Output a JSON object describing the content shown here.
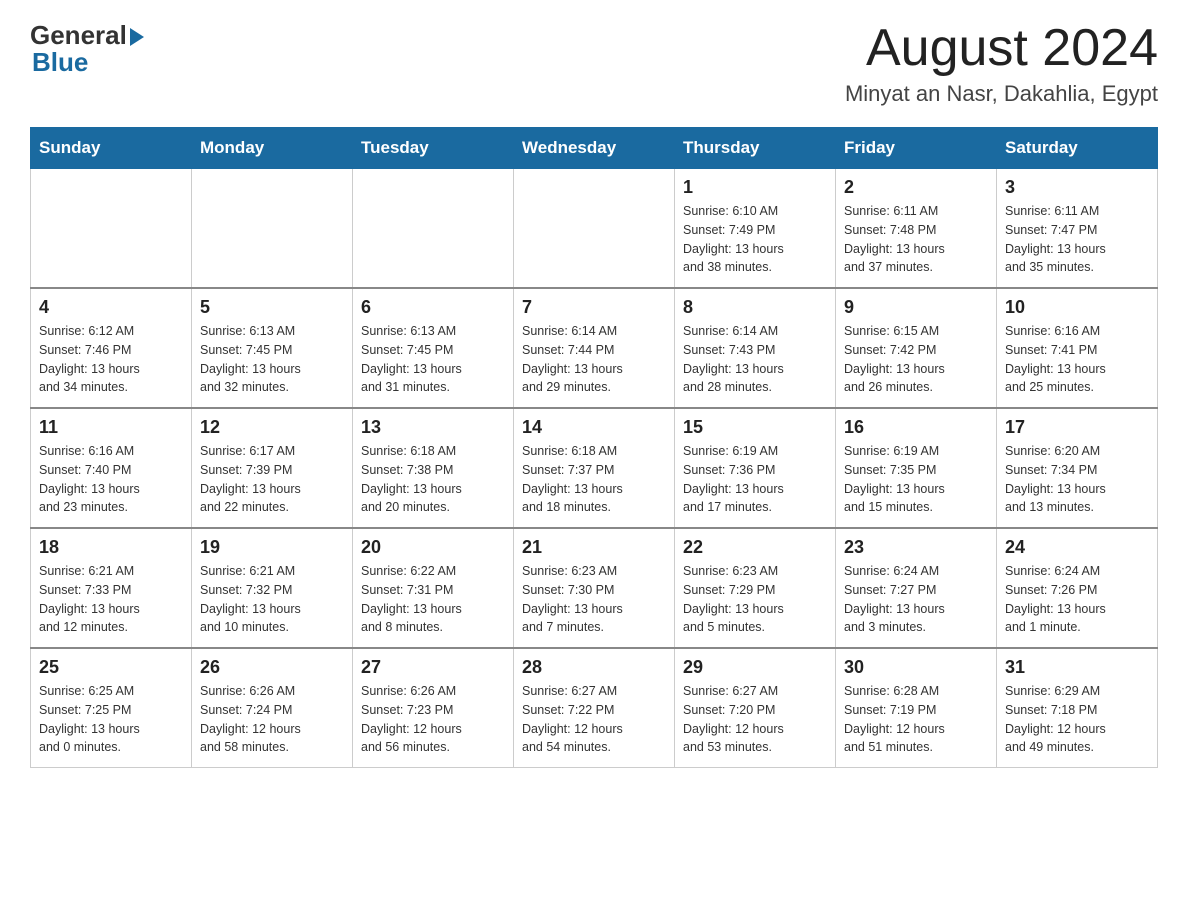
{
  "header": {
    "logo_general": "General",
    "logo_blue": "Blue",
    "month_title": "August 2024",
    "location": "Minyat an Nasr, Dakahlia, Egypt"
  },
  "days_of_week": [
    "Sunday",
    "Monday",
    "Tuesday",
    "Wednesday",
    "Thursday",
    "Friday",
    "Saturday"
  ],
  "weeks": [
    [
      {
        "day": "",
        "info": ""
      },
      {
        "day": "",
        "info": ""
      },
      {
        "day": "",
        "info": ""
      },
      {
        "day": "",
        "info": ""
      },
      {
        "day": "1",
        "info": "Sunrise: 6:10 AM\nSunset: 7:49 PM\nDaylight: 13 hours\nand 38 minutes."
      },
      {
        "day": "2",
        "info": "Sunrise: 6:11 AM\nSunset: 7:48 PM\nDaylight: 13 hours\nand 37 minutes."
      },
      {
        "day": "3",
        "info": "Sunrise: 6:11 AM\nSunset: 7:47 PM\nDaylight: 13 hours\nand 35 minutes."
      }
    ],
    [
      {
        "day": "4",
        "info": "Sunrise: 6:12 AM\nSunset: 7:46 PM\nDaylight: 13 hours\nand 34 minutes."
      },
      {
        "day": "5",
        "info": "Sunrise: 6:13 AM\nSunset: 7:45 PM\nDaylight: 13 hours\nand 32 minutes."
      },
      {
        "day": "6",
        "info": "Sunrise: 6:13 AM\nSunset: 7:45 PM\nDaylight: 13 hours\nand 31 minutes."
      },
      {
        "day": "7",
        "info": "Sunrise: 6:14 AM\nSunset: 7:44 PM\nDaylight: 13 hours\nand 29 minutes."
      },
      {
        "day": "8",
        "info": "Sunrise: 6:14 AM\nSunset: 7:43 PM\nDaylight: 13 hours\nand 28 minutes."
      },
      {
        "day": "9",
        "info": "Sunrise: 6:15 AM\nSunset: 7:42 PM\nDaylight: 13 hours\nand 26 minutes."
      },
      {
        "day": "10",
        "info": "Sunrise: 6:16 AM\nSunset: 7:41 PM\nDaylight: 13 hours\nand 25 minutes."
      }
    ],
    [
      {
        "day": "11",
        "info": "Sunrise: 6:16 AM\nSunset: 7:40 PM\nDaylight: 13 hours\nand 23 minutes."
      },
      {
        "day": "12",
        "info": "Sunrise: 6:17 AM\nSunset: 7:39 PM\nDaylight: 13 hours\nand 22 minutes."
      },
      {
        "day": "13",
        "info": "Sunrise: 6:18 AM\nSunset: 7:38 PM\nDaylight: 13 hours\nand 20 minutes."
      },
      {
        "day": "14",
        "info": "Sunrise: 6:18 AM\nSunset: 7:37 PM\nDaylight: 13 hours\nand 18 minutes."
      },
      {
        "day": "15",
        "info": "Sunrise: 6:19 AM\nSunset: 7:36 PM\nDaylight: 13 hours\nand 17 minutes."
      },
      {
        "day": "16",
        "info": "Sunrise: 6:19 AM\nSunset: 7:35 PM\nDaylight: 13 hours\nand 15 minutes."
      },
      {
        "day": "17",
        "info": "Sunrise: 6:20 AM\nSunset: 7:34 PM\nDaylight: 13 hours\nand 13 minutes."
      }
    ],
    [
      {
        "day": "18",
        "info": "Sunrise: 6:21 AM\nSunset: 7:33 PM\nDaylight: 13 hours\nand 12 minutes."
      },
      {
        "day": "19",
        "info": "Sunrise: 6:21 AM\nSunset: 7:32 PM\nDaylight: 13 hours\nand 10 minutes."
      },
      {
        "day": "20",
        "info": "Sunrise: 6:22 AM\nSunset: 7:31 PM\nDaylight: 13 hours\nand 8 minutes."
      },
      {
        "day": "21",
        "info": "Sunrise: 6:23 AM\nSunset: 7:30 PM\nDaylight: 13 hours\nand 7 minutes."
      },
      {
        "day": "22",
        "info": "Sunrise: 6:23 AM\nSunset: 7:29 PM\nDaylight: 13 hours\nand 5 minutes."
      },
      {
        "day": "23",
        "info": "Sunrise: 6:24 AM\nSunset: 7:27 PM\nDaylight: 13 hours\nand 3 minutes."
      },
      {
        "day": "24",
        "info": "Sunrise: 6:24 AM\nSunset: 7:26 PM\nDaylight: 13 hours\nand 1 minute."
      }
    ],
    [
      {
        "day": "25",
        "info": "Sunrise: 6:25 AM\nSunset: 7:25 PM\nDaylight: 13 hours\nand 0 minutes."
      },
      {
        "day": "26",
        "info": "Sunrise: 6:26 AM\nSunset: 7:24 PM\nDaylight: 12 hours\nand 58 minutes."
      },
      {
        "day": "27",
        "info": "Sunrise: 6:26 AM\nSunset: 7:23 PM\nDaylight: 12 hours\nand 56 minutes."
      },
      {
        "day": "28",
        "info": "Sunrise: 6:27 AM\nSunset: 7:22 PM\nDaylight: 12 hours\nand 54 minutes."
      },
      {
        "day": "29",
        "info": "Sunrise: 6:27 AM\nSunset: 7:20 PM\nDaylight: 12 hours\nand 53 minutes."
      },
      {
        "day": "30",
        "info": "Sunrise: 6:28 AM\nSunset: 7:19 PM\nDaylight: 12 hours\nand 51 minutes."
      },
      {
        "day": "31",
        "info": "Sunrise: 6:29 AM\nSunset: 7:18 PM\nDaylight: 12 hours\nand 49 minutes."
      }
    ]
  ]
}
